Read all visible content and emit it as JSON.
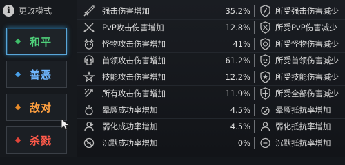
{
  "header": {
    "info_glyph": "i",
    "title": "更改模式"
  },
  "modes": [
    {
      "label": "和平",
      "color": "#4fd07a",
      "diamond": "#3fbf6a",
      "active": true
    },
    {
      "label": "善恶",
      "color": "#6fb7ff",
      "diamond": "#4aa0e8",
      "active": false
    },
    {
      "label": "敌对",
      "color": "#ffa040",
      "diamond": "#e88b2a",
      "active": false
    },
    {
      "label": "杀戮",
      "color": "#ff5a4a",
      "diamond": "#e0453a",
      "active": false
    }
  ],
  "stats": [
    {
      "left_icon": "sword-icon",
      "left": "强击伤害增加",
      "value": "35.2%",
      "right_icon": "shield-icon",
      "right": "所受强击伤害减少"
    },
    {
      "left_icon": "crossed-swords-icon",
      "left": "PvP攻击伤害增加",
      "value": "12.8%",
      "right_icon": "shield-swords-icon",
      "right": "所受PvP伤害减少"
    },
    {
      "left_icon": "monster-icon",
      "left": "怪物攻击伤害增加",
      "value": "41%",
      "right_icon": "shield-monster-icon",
      "right": "所受怪物伤害减少"
    },
    {
      "left_icon": "boss-skull-icon",
      "left": "首领攻击伤害增加",
      "value": "61.2%",
      "right_icon": "shield-boss-icon",
      "right": "所受首领伤害减少"
    },
    {
      "left_icon": "skill-icon",
      "left": "技能攻击伤害增加",
      "value": "12.2%",
      "right_icon": "shield-skill-icon",
      "right": "所受技能伤害减少"
    },
    {
      "left_icon": "all-attack-icon",
      "left": "所有攻击伤害增加",
      "value": "11.9%",
      "right_icon": "shield-all-icon",
      "right": "所受全部伤害减少"
    },
    {
      "left_icon": "stun-icon",
      "left": "晕厥成功率增加",
      "value": "4.5%",
      "right_icon": "stun-resist-icon",
      "right": "晕厥抵抗率增加"
    },
    {
      "left_icon": "weaken-icon",
      "left": "弱化成功率增加",
      "value": "4.5%",
      "right_icon": "weaken-resist-icon",
      "right": "弱化抵抗率增加"
    },
    {
      "left_icon": "silence-icon",
      "left": "沉默成功率增加",
      "value": "0%",
      "right_icon": "silence-resist-icon",
      "right": "沉默抵抗率增加"
    }
  ]
}
